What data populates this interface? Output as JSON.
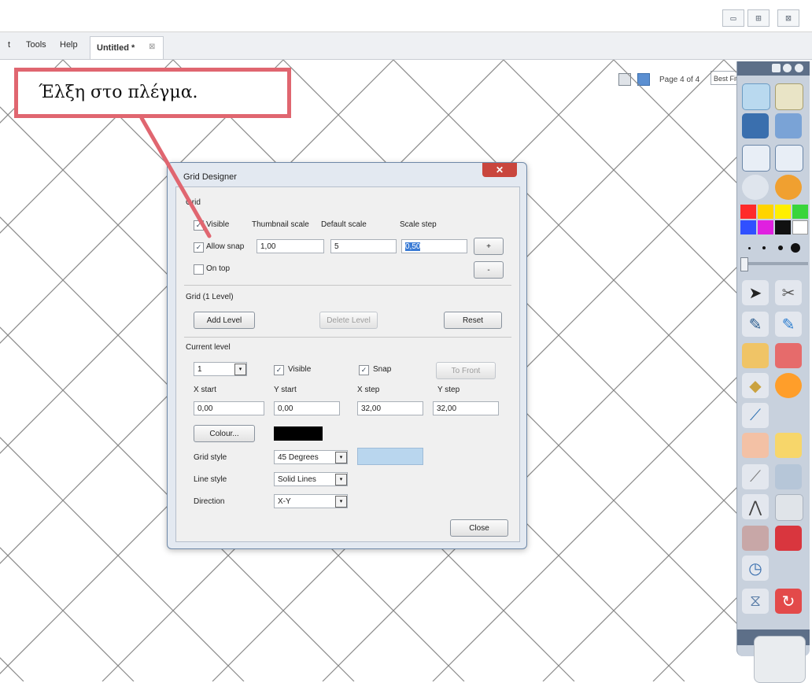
{
  "window_controls": [
    "▭",
    "⊞",
    "⊠"
  ],
  "menu": {
    "items": [
      "t",
      "Tools",
      "Help"
    ]
  },
  "doc_tab": {
    "title": "Untitled *",
    "close": "⊠"
  },
  "page_indicator": "Page 4 of 4",
  "zoom": {
    "value": "Best Fit",
    "drop": "▾"
  },
  "callout": {
    "text": "Έλξη στο πλέγμα."
  },
  "dialog": {
    "title": "Grid Designer",
    "close_glyph": "✕",
    "grid_section": "Grid",
    "visible_label": "Visible",
    "allow_snap_label": "Allow snap",
    "on_top_label": "On top",
    "thumbnail_scale_label": "Thumbnail scale",
    "default_scale_label": "Default scale",
    "scale_step_label": "Scale step",
    "thumbnail_scale": "1,00",
    "default_scale": "5",
    "scale_step": "0,50",
    "plus": "+",
    "minus": "-",
    "grid_levels_label": "Grid (1 Level)",
    "add_level": "Add Level",
    "delete_level": "Delete Level",
    "reset": "Reset",
    "current_level_label": "Current level",
    "level_value": "1",
    "level_visible": "Visible",
    "level_snap": "Snap",
    "to_front": "To Front",
    "x_start_label": "X start",
    "y_start_label": "Y start",
    "x_step_label": "X step",
    "y_step_label": "Y step",
    "x_start": "0,00",
    "y_start": "0,00",
    "x_step": "32,00",
    "y_step": "32,00",
    "colour_button": "Colour...",
    "grid_style_label": "Grid style",
    "grid_style": "45 Degrees",
    "line_style_label": "Line style",
    "line_style": "Solid Lines",
    "direction_label": "Direction",
    "direction": "X-Y",
    "close_button": "Close",
    "check": "✓",
    "drop": "▾"
  },
  "colors": {
    "callout_border": "#e06670",
    "grid_line": "#8a8a8a",
    "toolbox_bg": "#c8d1dd",
    "dialog_frame": "#e3e9f1"
  },
  "toolbox": {
    "palette": [
      "#ff2a2a",
      "#ffd400",
      "#ffef00",
      "#39d53b",
      "#3050ff",
      "#e020e0",
      "#111111",
      "#ffffff"
    ]
  }
}
